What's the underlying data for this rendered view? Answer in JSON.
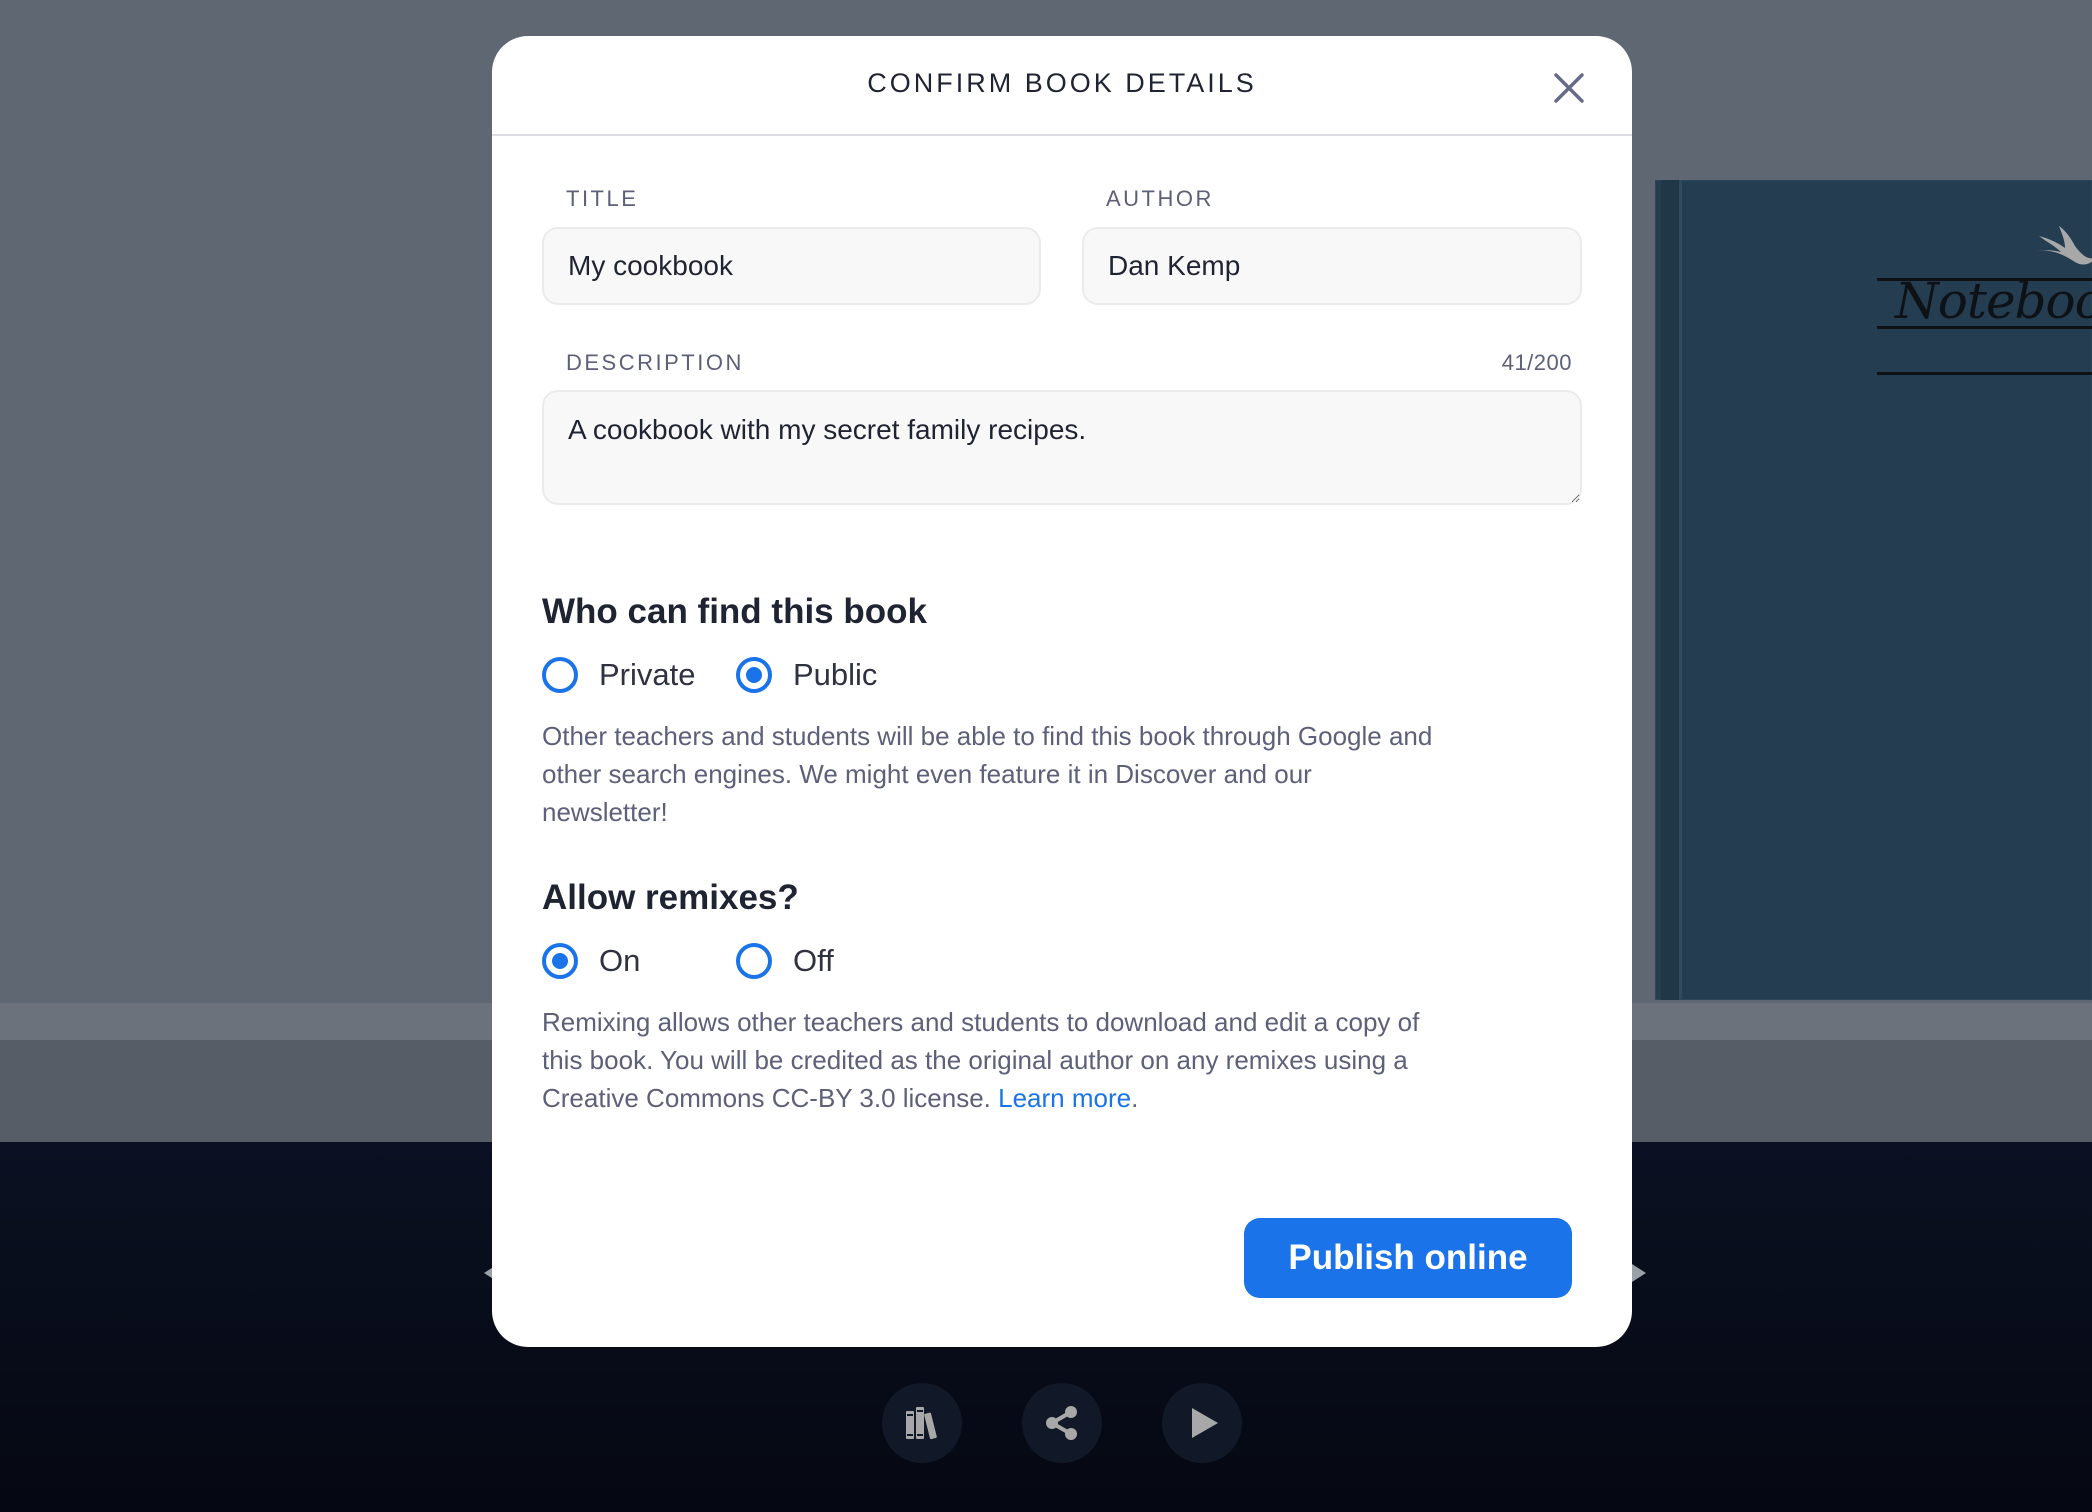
{
  "modal": {
    "title": "CONFIRM BOOK DETAILS",
    "close_icon": "close-icon",
    "fields": {
      "title": {
        "label": "TITLE",
        "value": "My cookbook"
      },
      "author": {
        "label": "AUTHOR",
        "value": "Dan Kemp"
      },
      "description": {
        "label": "DESCRIPTION",
        "value": "A cookbook with my secret family recipes.",
        "counter": "41/200"
      }
    },
    "visibility": {
      "heading": "Who can find this book",
      "options": [
        {
          "label": "Private",
          "checked": false
        },
        {
          "label": "Public",
          "checked": true
        }
      ],
      "help": "Other teachers and students will be able to find this book through Google and other search engines. We might even feature it in Discover and our newsletter!"
    },
    "remixes": {
      "heading": "Allow remixes?",
      "options": [
        {
          "label": "On",
          "checked": true
        },
        {
          "label": "Off",
          "checked": false
        }
      ],
      "help": "Remixing allows other teachers and students to download and edit a copy of this book. You will be credited as the original author on any remixes using a Creative Commons CC-BY 3.0 license.",
      "link_label": "Learn more",
      "link_suffix": "."
    },
    "publish_label": "Publish online"
  },
  "background": {
    "book_cover_title": "Notebook"
  },
  "dock": {
    "items": [
      {
        "name": "library",
        "icon": "books-icon"
      },
      {
        "name": "share",
        "icon": "share-icon"
      },
      {
        "name": "play",
        "icon": "play-icon"
      }
    ]
  },
  "colors": {
    "accent": "#1a73e8",
    "overlay": "#5f6773",
    "footer": "#0b1122"
  }
}
